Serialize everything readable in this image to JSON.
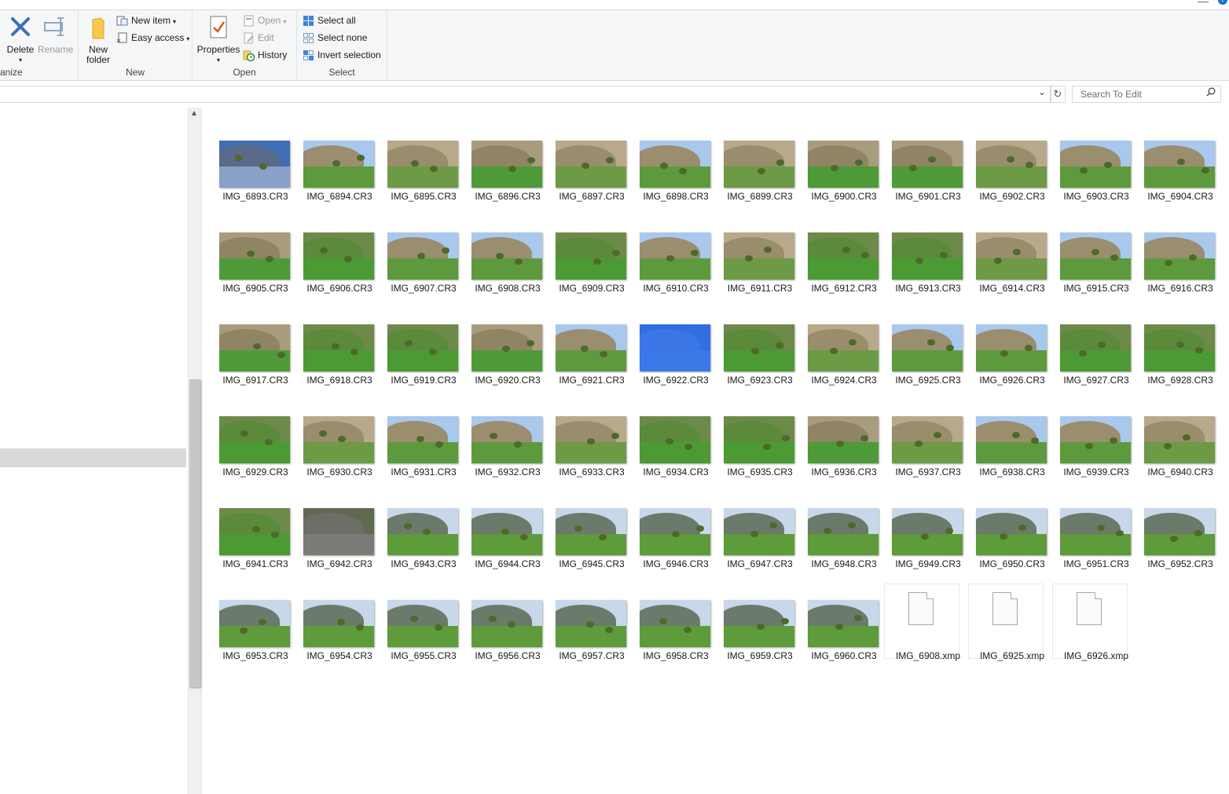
{
  "window": {
    "minimize_glyph": "—",
    "help_glyph": "?"
  },
  "ribbon": {
    "organize": {
      "group_label": "anize",
      "delete_label": "Delete",
      "rename_label": "Rename"
    },
    "new": {
      "group_label": "New",
      "new_folder_label": "New folder",
      "new_item_label": "New item",
      "easy_access_label": "Easy access"
    },
    "open": {
      "group_label": "Open",
      "properties_label": "Properties",
      "open_label": "Open",
      "edit_label": "Edit",
      "history_label": "History"
    },
    "select": {
      "group_label": "Select",
      "select_all_label": "Select all",
      "select_none_label": "Select none",
      "invert_selection_label": "Invert selection"
    }
  },
  "address": {
    "path": "",
    "refresh_glyph": "↻",
    "dropdown_glyph": "⌄"
  },
  "search": {
    "placeholder": "Search To Edit",
    "icon": "search-icon"
  },
  "files": [
    {
      "name": "IMG_6893.CR3",
      "kind": "sky_tree"
    },
    {
      "name": "IMG_6894.CR3",
      "kind": "hill_sky"
    },
    {
      "name": "IMG_6895.CR3",
      "kind": "hill"
    },
    {
      "name": "IMG_6896.CR3",
      "kind": "hill_field"
    },
    {
      "name": "IMG_6897.CR3",
      "kind": "hill"
    },
    {
      "name": "IMG_6898.CR3",
      "kind": "hill_sky"
    },
    {
      "name": "IMG_6899.CR3",
      "kind": "hill"
    },
    {
      "name": "IMG_6900.CR3",
      "kind": "hill_field"
    },
    {
      "name": "IMG_6901.CR3",
      "kind": "hill_field"
    },
    {
      "name": "IMG_6902.CR3",
      "kind": "hill"
    },
    {
      "name": "IMG_6903.CR3",
      "kind": "hill_sky"
    },
    {
      "name": "IMG_6904.CR3",
      "kind": "hill_sky"
    },
    {
      "name": "IMG_6905.CR3",
      "kind": "hill_field"
    },
    {
      "name": "IMG_6906.CR3",
      "kind": "field"
    },
    {
      "name": "IMG_6907.CR3",
      "kind": "hill_sky"
    },
    {
      "name": "IMG_6908.CR3",
      "kind": "hill_sky"
    },
    {
      "name": "IMG_6909.CR3",
      "kind": "field"
    },
    {
      "name": "IMG_6910.CR3",
      "kind": "hill_sky"
    },
    {
      "name": "IMG_6911.CR3",
      "kind": "hill"
    },
    {
      "name": "IMG_6912.CR3",
      "kind": "field"
    },
    {
      "name": "IMG_6913.CR3",
      "kind": "field"
    },
    {
      "name": "IMG_6914.CR3",
      "kind": "hill"
    },
    {
      "name": "IMG_6915.CR3",
      "kind": "hill_sky"
    },
    {
      "name": "IMG_6916.CR3",
      "kind": "hill_sky"
    },
    {
      "name": "IMG_6917.CR3",
      "kind": "hill_field"
    },
    {
      "name": "IMG_6918.CR3",
      "kind": "field"
    },
    {
      "name": "IMG_6919.CR3",
      "kind": "field"
    },
    {
      "name": "IMG_6920.CR3",
      "kind": "hill_field"
    },
    {
      "name": "IMG_6921.CR3",
      "kind": "hill_sky"
    },
    {
      "name": "IMG_6922.CR3",
      "kind": "blue_sky"
    },
    {
      "name": "IMG_6923.CR3",
      "kind": "field"
    },
    {
      "name": "IMG_6924.CR3",
      "kind": "hill"
    },
    {
      "name": "IMG_6925.CR3",
      "kind": "hill_sky"
    },
    {
      "name": "IMG_6926.CR3",
      "kind": "hill_sky"
    },
    {
      "name": "IMG_6927.CR3",
      "kind": "field"
    },
    {
      "name": "IMG_6928.CR3",
      "kind": "field"
    },
    {
      "name": "IMG_6929.CR3",
      "kind": "field"
    },
    {
      "name": "IMG_6930.CR3",
      "kind": "hill"
    },
    {
      "name": "IMG_6931.CR3",
      "kind": "hill_sky"
    },
    {
      "name": "IMG_6932.CR3",
      "kind": "hill_sky"
    },
    {
      "name": "IMG_6933.CR3",
      "kind": "hill"
    },
    {
      "name": "IMG_6934.CR3",
      "kind": "field"
    },
    {
      "name": "IMG_6935.CR3",
      "kind": "field"
    },
    {
      "name": "IMG_6936.CR3",
      "kind": "hill_field"
    },
    {
      "name": "IMG_6937.CR3",
      "kind": "hill"
    },
    {
      "name": "IMG_6938.CR3",
      "kind": "hill_sky"
    },
    {
      "name": "IMG_6939.CR3",
      "kind": "hill_sky"
    },
    {
      "name": "IMG_6940.CR3",
      "kind": "hill"
    },
    {
      "name": "IMG_6941.CR3",
      "kind": "field"
    },
    {
      "name": "IMG_6942.CR3",
      "kind": "gravel"
    },
    {
      "name": "IMG_6943.CR3",
      "kind": "valley"
    },
    {
      "name": "IMG_6944.CR3",
      "kind": "valley"
    },
    {
      "name": "IMG_6945.CR3",
      "kind": "valley"
    },
    {
      "name": "IMG_6946.CR3",
      "kind": "valley"
    },
    {
      "name": "IMG_6947.CR3",
      "kind": "valley"
    },
    {
      "name": "IMG_6948.CR3",
      "kind": "valley"
    },
    {
      "name": "IMG_6949.CR3",
      "kind": "valley"
    },
    {
      "name": "IMG_6950.CR3",
      "kind": "valley"
    },
    {
      "name": "IMG_6951.CR3",
      "kind": "valley"
    },
    {
      "name": "IMG_6952.CR3",
      "kind": "valley"
    },
    {
      "name": "IMG_6953.CR3",
      "kind": "valley"
    },
    {
      "name": "IMG_6954.CR3",
      "kind": "valley"
    },
    {
      "name": "IMG_6955.CR3",
      "kind": "valley"
    },
    {
      "name": "IMG_6956.CR3",
      "kind": "valley"
    },
    {
      "name": "IMG_6957.CR3",
      "kind": "valley"
    },
    {
      "name": "IMG_6958.CR3",
      "kind": "valley"
    },
    {
      "name": "IMG_6959.CR3",
      "kind": "valley"
    },
    {
      "name": "IMG_6960.CR3",
      "kind": "valley"
    },
    {
      "name": "IMG_6908.xmp",
      "kind": "file"
    },
    {
      "name": "IMG_6925.xmp",
      "kind": "file"
    },
    {
      "name": "IMG_6926.xmp",
      "kind": "file"
    }
  ]
}
